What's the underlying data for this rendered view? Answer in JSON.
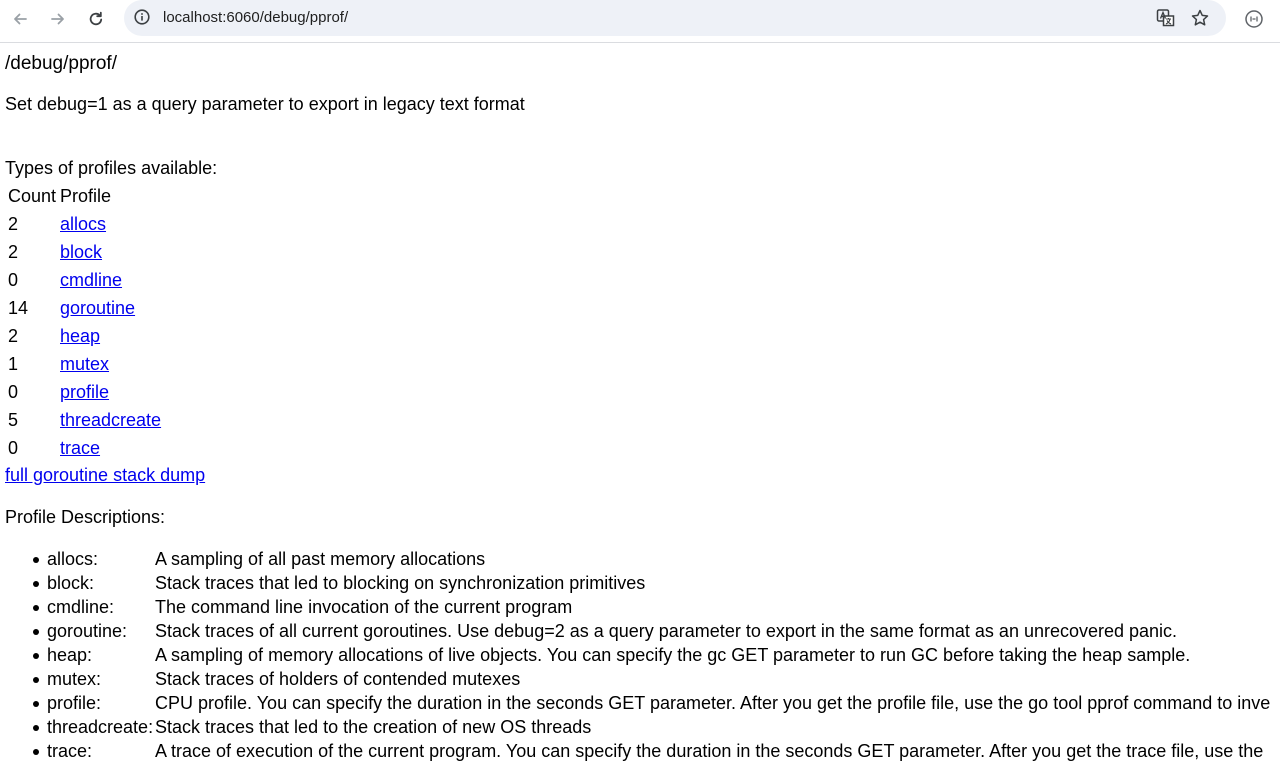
{
  "browser": {
    "url": "localhost:6060/debug/pprof/"
  },
  "page": {
    "title": "/debug/pprof/",
    "intro": "Set debug=1 as a query parameter to export in legacy text format",
    "types_heading": "Types of profiles available:",
    "table": {
      "headers": [
        "Count",
        "Profile"
      ],
      "rows": [
        {
          "count": "2",
          "profile": "allocs"
        },
        {
          "count": "2",
          "profile": "block"
        },
        {
          "count": "0",
          "profile": "cmdline"
        },
        {
          "count": "14",
          "profile": "goroutine"
        },
        {
          "count": "2",
          "profile": "heap"
        },
        {
          "count": "1",
          "profile": "mutex"
        },
        {
          "count": "0",
          "profile": "profile"
        },
        {
          "count": "5",
          "profile": "threadcreate"
        },
        {
          "count": "0",
          "profile": "trace"
        }
      ]
    },
    "dump_link": "full goroutine stack dump",
    "descriptions_heading": "Profile Descriptions:",
    "descriptions": [
      {
        "name": "allocs:",
        "text": "A sampling of all past memory allocations"
      },
      {
        "name": "block:",
        "text": "Stack traces that led to blocking on synchronization primitives"
      },
      {
        "name": "cmdline:",
        "text": "The command line invocation of the current program"
      },
      {
        "name": "goroutine:",
        "text": "Stack traces of all current goroutines. Use debug=2 as a query parameter to export in the same format as an unrecovered panic."
      },
      {
        "name": "heap:",
        "text": "A sampling of memory allocations of live objects. You can specify the gc GET parameter to run GC before taking the heap sample."
      },
      {
        "name": "mutex:",
        "text": "Stack traces of holders of contended mutexes"
      },
      {
        "name": "profile:",
        "text": "CPU profile. You can specify the duration in the seconds GET parameter. After you get the profile file, use the go tool pprof command to inve"
      },
      {
        "name": "threadcreate:",
        "text": "Stack traces that led to the creation of new OS threads"
      },
      {
        "name": "trace:",
        "text": "A trace of execution of the current program. You can specify the duration in the seconds GET parameter. After you get the trace file, use the"
      }
    ]
  },
  "colors": {
    "link": "#0000ee",
    "omnibox_bg": "#eef1f7",
    "toolbar_icon": "#5f6368"
  },
  "icons": {
    "back": "arrow-left-icon",
    "forward": "arrow-right-icon",
    "reload": "reload-icon",
    "info": "info-icon",
    "translate": "translate-icon",
    "bookmark": "star-icon",
    "extension": "profile-icon"
  }
}
